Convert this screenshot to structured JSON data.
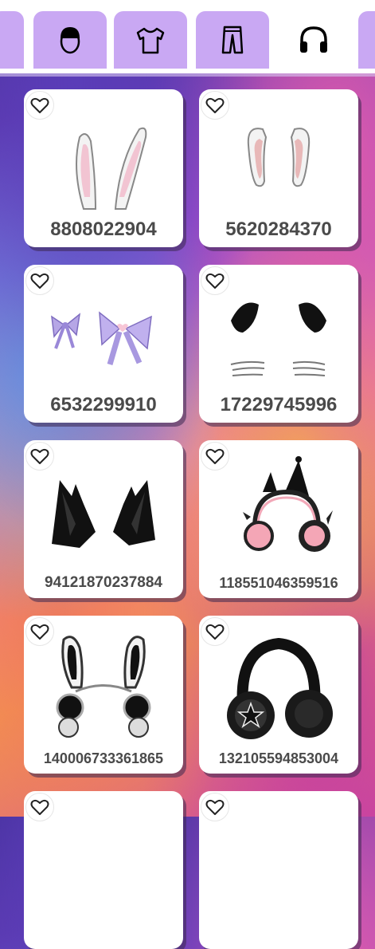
{
  "tabs": [
    {
      "name": "partial-left-tab",
      "icon": "hair-icon",
      "active": false
    },
    {
      "name": "tab-head",
      "icon": "head-icon",
      "active": false
    },
    {
      "name": "tab-shirts",
      "icon": "shirt-icon",
      "active": false
    },
    {
      "name": "tab-pants",
      "icon": "pants-icon",
      "active": false
    },
    {
      "name": "tab-accessories",
      "icon": "headphones-icon",
      "active": true
    }
  ],
  "items": [
    {
      "id": "8808022904",
      "thumb": "white-bunny-ears"
    },
    {
      "id": "5620284370",
      "thumb": "droopy-bunny-ears"
    },
    {
      "id": "6532299910",
      "thumb": "purple-bows"
    },
    {
      "id": "17229745996",
      "thumb": "black-cat-ears-whiskers"
    },
    {
      "id": "94121870237884",
      "thumb": "black-fluffy-ears"
    },
    {
      "id": "118551046359516",
      "thumb": "pink-black-headphones"
    },
    {
      "id": "140006733361865",
      "thumb": "black-bunny-headband"
    },
    {
      "id": "132105594853004",
      "thumb": "star-headphones"
    }
  ]
}
